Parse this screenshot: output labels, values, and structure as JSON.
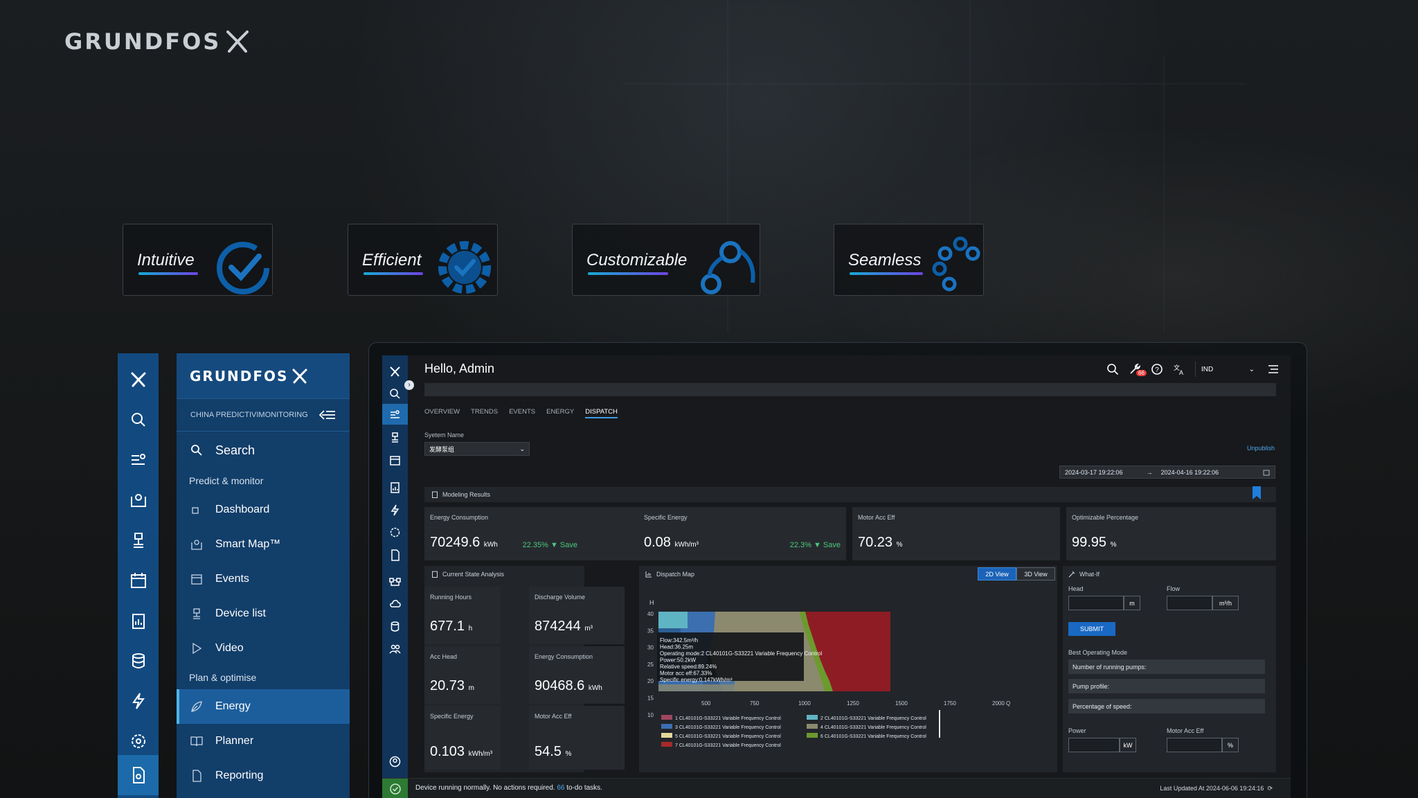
{
  "brand": {
    "name": "GRUNDFOS"
  },
  "features": [
    {
      "label": "Intuitive"
    },
    {
      "label": "Efficient"
    },
    {
      "label": "Customizable"
    },
    {
      "label": "Seamless"
    }
  ],
  "menu": {
    "brand": "GRUNDFOS",
    "subtitle": "CHINA PREDICTIVIMONITORING",
    "search": "Search",
    "section1": "Predict & monitor",
    "items1": [
      "Dashboard",
      "Smart Map™",
      "Events",
      "Device list",
      "Video"
    ],
    "section2": "Plan & optimise",
    "items2": [
      "Energy",
      "Planner",
      "Reporting"
    ],
    "active": "Energy"
  },
  "app": {
    "greeting": "Hello, Admin",
    "notification_count": "66",
    "org_select": "IND",
    "tabs": [
      "OVERVIEW",
      "TRENDS",
      "EVENTS",
      "ENERGY",
      "DISPATCH"
    ],
    "active_tab": "DISPATCH",
    "system_name_label": "Syetem Name",
    "system_name_value": "发酵泵组",
    "unpublish": "Unpublish",
    "date_from": "2024-03-17 19:22:06",
    "date_arrow": "→",
    "date_to": "2024-04-16 19:22:06",
    "modeling_results": "Modeling Results",
    "kpis": [
      {
        "title": "Energy Consumption",
        "value": "70249.6",
        "unit": "kWh",
        "save": "22.35% ▼ Save"
      },
      {
        "title": "Specific Energy",
        "value": "0.08",
        "unit": "kWh/m³",
        "save": "22.3% ▼ Save"
      },
      {
        "title": "Motor Acc Eff",
        "value": "70.23",
        "unit": "%"
      },
      {
        "title": "Optimizable Percentage",
        "value": "99.95",
        "unit": "%"
      }
    ],
    "current_state": {
      "title": "Current State Analysis",
      "cells": [
        {
          "title": "Running Hours",
          "value": "677.1",
          "unit": "h"
        },
        {
          "title": "Discharge Volume",
          "value": "874244",
          "unit": "m³"
        },
        {
          "title": "Acc Head",
          "value": "20.73",
          "unit": "m"
        },
        {
          "title": "Energy Consumption",
          "value": "90468.6",
          "unit": "kWh"
        },
        {
          "title": "Specific Energy",
          "value": "0.103",
          "unit": "kWh/m³"
        },
        {
          "title": "Motor Acc Eff",
          "value": "54.5",
          "unit": "%"
        }
      ]
    },
    "dispatch_map": {
      "title": "Dispatch Map",
      "view2d": "2D View",
      "view3d": "3D View",
      "y_label": "H",
      "y_ticks": [
        "40",
        "35",
        "30",
        "25",
        "20",
        "15",
        "10"
      ],
      "x_ticks": [
        "500",
        "750",
        "1000",
        "1250",
        "1500",
        "1750",
        "2000 Q"
      ],
      "tooltip": [
        "Flow:342.5m³/h",
        "Head:36.25m",
        "Operating mode:2 CL40101G-S33221 Variable Frequency Control",
        "Power:50.2kW",
        "Relative speed:89.24%",
        "Motor acc eff:67.33%",
        "Specific energy:0.147kWh/m³"
      ],
      "legend": [
        {
          "label": "1 CL40101G-S33221 Variable Frequency Control",
          "color": "#a04660"
        },
        {
          "label": "2 CL40101G-S33221 Variable Frequency Control",
          "color": "#5fb4c4"
        },
        {
          "label": "3 CL40101G-S33221 Variable Frequency Control",
          "color": "#3c6fb0"
        },
        {
          "label": "4 CL40101G-S33221 Variable Frequency Control",
          "color": "#8c8a6e"
        },
        {
          "label": "5 CL40101G-S33221 Variable Frequency Control",
          "color": "#e4d89a"
        },
        {
          "label": "6 CL40101G-S33221 Variable Frequency Control",
          "color": "#6c9a2e"
        },
        {
          "label": "7 CL40101G-S33221 Variable Frequency Control",
          "color": "#a52a2a"
        }
      ]
    },
    "what_if": {
      "title": "What-If",
      "head_label": "Head",
      "head_unit": "m",
      "flow_label": "Flow",
      "flow_unit": "m³/h",
      "submit": "SUBMIT",
      "best_mode": "Best Operating Mode",
      "rows": [
        "Number of running pumps:",
        "Pump profile:",
        "Percentage of speed:"
      ],
      "power_label": "Power",
      "power_unit": "kW",
      "eff_label": "Motor Acc Eff",
      "eff_unit": "%"
    },
    "status": {
      "msg_before": "Device running normally. No actions required.",
      "count": "66",
      "msg_after": "to-do tasks.",
      "updated": "Last Updated At 2024-06-06 19:24:16"
    }
  },
  "colors": {
    "accent": "#1c6aa9",
    "rail": "#124a80",
    "save_green": "#4cc87a",
    "link_blue": "#4aa8f0"
  }
}
